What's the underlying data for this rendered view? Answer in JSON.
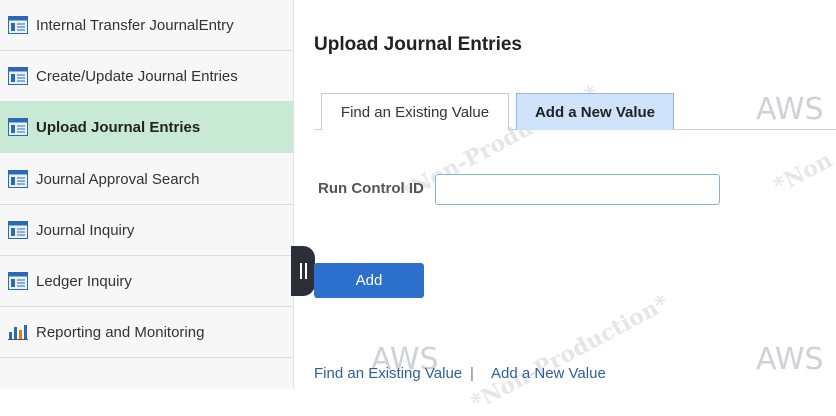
{
  "sidebar": {
    "items": [
      {
        "label": "Internal Transfer JournalEntry",
        "icon": "component-page-icon",
        "active": false
      },
      {
        "label": "Create/Update Journal Entries",
        "icon": "component-page-icon",
        "active": false
      },
      {
        "label": "Upload Journal Entries",
        "icon": "component-page-icon",
        "active": true
      },
      {
        "label": "Journal Approval Search",
        "icon": "component-page-icon",
        "active": false
      },
      {
        "label": "Journal Inquiry",
        "icon": "component-page-icon",
        "active": false
      },
      {
        "label": "Ledger Inquiry",
        "icon": "component-page-icon",
        "active": false
      },
      {
        "label": "Reporting and Monitoring",
        "icon": "bar-chart-icon",
        "active": false
      }
    ]
  },
  "main": {
    "title": "Upload Journal Entries",
    "tabs": [
      {
        "label": "Find an Existing Value",
        "active": false
      },
      {
        "label": "Add a New Value",
        "active": true
      }
    ],
    "run_control_label": "Run Control ID",
    "run_control_value": "",
    "add_button_label": "Add",
    "footer_links": {
      "find": "Find an Existing Value",
      "separator": "|",
      "add": "Add a New Value"
    }
  },
  "watermarks": {
    "aws": "AWS",
    "non_production": "*Non-Production*",
    "non_short": "*Non"
  },
  "colors": {
    "active_nav": "#c8ead5",
    "active_tab": "#cfe3fb",
    "primary_button": "#2d6fcc",
    "link": "#2d5f9e"
  }
}
